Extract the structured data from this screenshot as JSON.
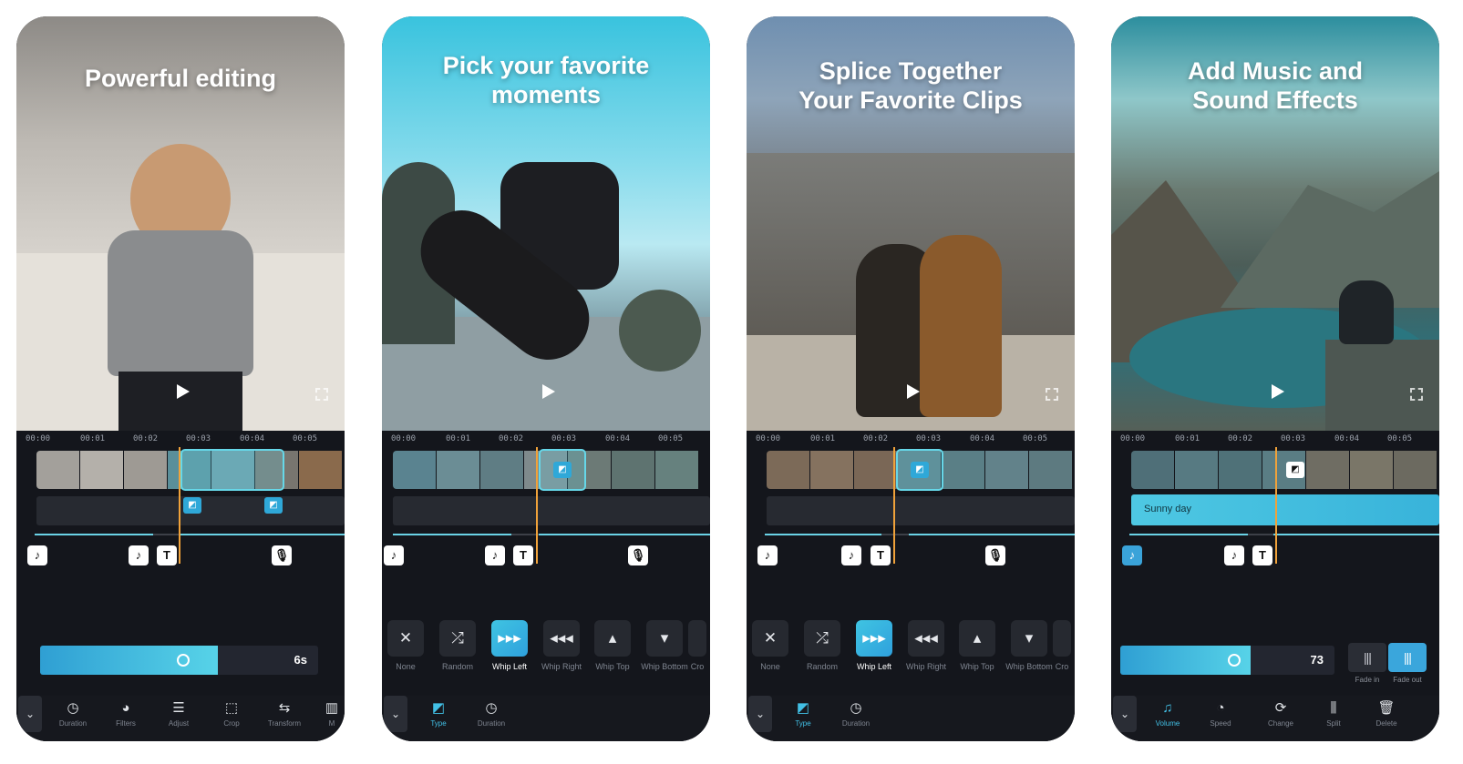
{
  "colors": {
    "accent": "#42c0e6",
    "playhead": "#f0a23a",
    "panel": "#14161c"
  },
  "screens": [
    {
      "title": "Powerful editing",
      "ticks": [
        "00:00",
        "00:01",
        "00:02",
        "00:03",
        "00:04",
        "00:05"
      ],
      "slider_value": "6s",
      "tools": [
        "Duration",
        "Filters",
        "Adjust",
        "Crop",
        "Transform",
        "M"
      ]
    },
    {
      "title": "Pick your favorite moments",
      "ticks": [
        "00:00",
        "00:01",
        "00:02",
        "00:03",
        "00:04",
        "00:05"
      ],
      "transitions": [
        "None",
        "Random",
        "Whip Left",
        "Whip Right",
        "Whip Top",
        "Whip Bottom",
        "Cro"
      ],
      "tools": [
        "Type",
        "Duration"
      ]
    },
    {
      "title": "Splice Together Your Favorite Clips",
      "ticks": [
        "00:00",
        "00:01",
        "00:02",
        "00:03",
        "00:04",
        "00:05"
      ],
      "transitions": [
        "None",
        "Random",
        "Whip Left",
        "Whip Right",
        "Whip Top",
        "Whip Bottom",
        "Cro"
      ],
      "tools": [
        "Type",
        "Duration"
      ]
    },
    {
      "title": "Add Music and Sound Effects",
      "ticks": [
        "00:00",
        "00:01",
        "00:02",
        "00:03",
        "00:04",
        "00:05"
      ],
      "music_label": "Sunny day",
      "volume_value": "73",
      "fade_in": "Fade in",
      "fade_out": "Fade out",
      "tools": [
        "Volume",
        "Speed",
        "Change",
        "Split",
        "Delete"
      ]
    }
  ]
}
